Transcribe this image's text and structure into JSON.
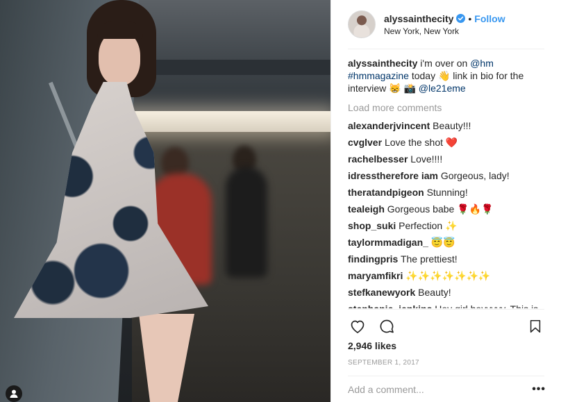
{
  "post": {
    "username": "alyssainthecity",
    "follow_label": "Follow",
    "location": "New York, New York",
    "caption": {
      "username": "alyssainthecity",
      "text_1": " i'm over on ",
      "mention_1": "@hm",
      "hashtag": "#hmmagazine",
      "text_2": " today 👋 link in bio for the interview 😸 📸 ",
      "mention_2": "@le21eme"
    },
    "load_more_label": "Load more comments",
    "comments": [
      {
        "user": "alexanderjvincent",
        "text": "Beauty!!!"
      },
      {
        "user": "cvglver",
        "text": "Love the shot ❤️"
      },
      {
        "user": "rachelbesser",
        "text": "Love!!!!"
      },
      {
        "user": "idresstherefore iam",
        "text": "Gorgeous, lady!"
      },
      {
        "user": "theratandpigeon",
        "text": "Stunning!"
      },
      {
        "user": "tealeigh",
        "text": "Gorgeous babe 🌹🔥🌹"
      },
      {
        "user": "shop_suki",
        "text": "Perfection ✨"
      },
      {
        "user": "taylormmadigan_",
        "text": "😇😇"
      },
      {
        "user": "findingpris",
        "text": "The prettiest!"
      },
      {
        "user": "maryamfikri",
        "text": "✨✨✨✨✨✨✨"
      },
      {
        "user": "stefkanewyork",
        "text": "Beauty!"
      },
      {
        "user": "stephanie_jenkins",
        "text": "Hey girl heyyyyy. This is"
      }
    ],
    "likes": "2,946 likes",
    "date": "SEPTEMBER 1, 2017",
    "add_comment_placeholder": "Add a comment...",
    "more_label": "•••"
  },
  "icons": {
    "verified": "verified-badge-icon",
    "like": "heart-icon",
    "comment": "comment-bubble-icon",
    "save": "bookmark-icon",
    "tag": "user-tag-icon"
  },
  "colors": {
    "follow": "#3897f0",
    "verified": "#3897f0",
    "muted": "#999999",
    "link": "#003569"
  }
}
